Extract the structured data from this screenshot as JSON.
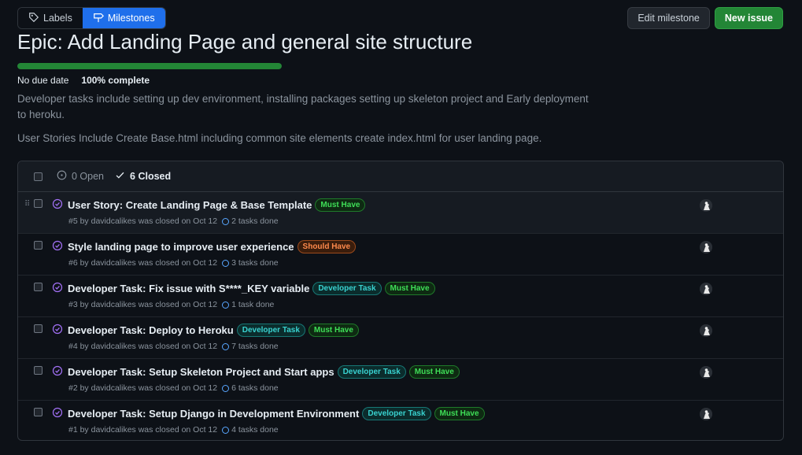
{
  "nav": {
    "labels_tab": "Labels",
    "milestones_tab": "Milestones"
  },
  "actions": {
    "edit_milestone": "Edit milestone",
    "new_issue": "New issue"
  },
  "milestone": {
    "title": "Epic: Add Landing Page and general site structure",
    "progress_fraction": 1.0,
    "due": "No due date",
    "complete": "100% complete",
    "description": [
      "Developer tasks include setting up dev environment, installing packages setting up skeleton project and Early deployment to heroku.",
      "User Stories Include Create Base.html including common site elements create index.html for user landing page."
    ]
  },
  "list_header": {
    "open": "0 Open",
    "closed": "6 Closed"
  },
  "issues": [
    {
      "title": "User Story: Create Landing Page & Base Template",
      "labels": [
        {
          "text": "Must Have",
          "kind": "must"
        }
      ],
      "meta": "#5 by davidcalikes was closed on Oct 12",
      "tasks": "2 tasks done"
    },
    {
      "title": "Style landing page to improve user experience",
      "labels": [
        {
          "text": "Should Have",
          "kind": "should"
        }
      ],
      "meta": "#6 by davidcalikes was closed on Oct 12",
      "tasks": "3 tasks done"
    },
    {
      "title": "Developer Task: Fix issue with S****_KEY variable",
      "labels": [
        {
          "text": "Developer Task",
          "kind": "dev"
        },
        {
          "text": "Must Have",
          "kind": "must"
        }
      ],
      "meta": "#3 by davidcalikes was closed on Oct 12",
      "tasks": "1 task done"
    },
    {
      "title": "Developer Task: Deploy to Heroku",
      "labels": [
        {
          "text": "Developer Task",
          "kind": "dev"
        },
        {
          "text": "Must Have",
          "kind": "must"
        }
      ],
      "meta": "#4 by davidcalikes was closed on Oct 12",
      "tasks": "7 tasks done"
    },
    {
      "title": "Developer Task: Setup Skeleton Project and Start apps",
      "labels": [
        {
          "text": "Developer Task",
          "kind": "dev"
        },
        {
          "text": "Must Have",
          "kind": "must"
        }
      ],
      "meta": "#2 by davidcalikes was closed on Oct 12",
      "tasks": "6 tasks done"
    },
    {
      "title": "Developer Task: Setup Django in Development Environment",
      "labels": [
        {
          "text": "Developer Task",
          "kind": "dev"
        },
        {
          "text": "Must Have",
          "kind": "must"
        }
      ],
      "meta": "#1 by davidcalikes was closed on Oct 12",
      "tasks": "4 tasks done"
    }
  ],
  "colors": {
    "accent": "#1f6feb",
    "success": "#238636",
    "closed_icon": "#a371f7"
  }
}
